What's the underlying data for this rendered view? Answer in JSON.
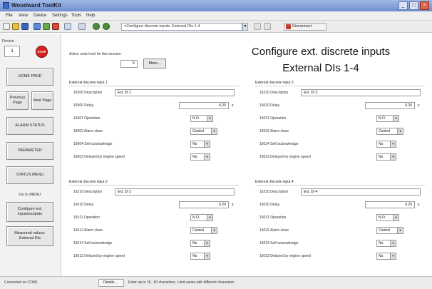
{
  "window": {
    "title": "Woodward ToolKit",
    "buttons": {
      "minimize": "_",
      "maximize": "□",
      "close": "×"
    }
  },
  "menu": [
    "File",
    "View",
    "Device",
    "Settings",
    "Tools",
    "Help"
  ],
  "toolbar": {
    "page_combo": "<Configure discrete inputs: External DIs 1-4",
    "disconnect_label": "Disconnect"
  },
  "sidebar": {
    "device_label": "Device",
    "device_value": "1",
    "stop_label": "STOP",
    "home_page": "HOME PAGE",
    "previous_page": "Previous Page",
    "next_page": "Next Page",
    "alarm_status": "ALARM STATUS",
    "parameter": "PARAMETER",
    "status_menu": "STATUS MENU",
    "goto_menu": "Go to MENU",
    "configure_ext": "Configure ext. inputs/outputs",
    "measured_values": "Measured values: External DIs"
  },
  "header": {
    "title": "Configure ext. discrete inputs",
    "subtitle": "External DIs 1-4",
    "access_code_label": "Active code level for this session:",
    "access_code_value": "5",
    "more_button": "More..."
  },
  "groups": [
    {
      "title": "External discrete input 1",
      "desc_label": "16200 Description",
      "desc_value": "Ext. DI 1",
      "delay_label": "16000 Delay",
      "delay_value": "0.20",
      "unit": "s",
      "operation_label": "16001 Operation",
      "operation_value": "N.O.",
      "alarm_label": "16002 Alarm class",
      "alarm_value": "Control",
      "selfack_label": "16004 Self acknowledge",
      "selfack_value": "No",
      "engine_label": "16003 Delayed by engine speed",
      "engine_value": "No"
    },
    {
      "title": "External discrete input 3",
      "desc_label": "16220 Description",
      "desc_value": "Ext. DI 3",
      "delay_label": "16020 Delay",
      "delay_value": "0.20",
      "unit": "s",
      "operation_label": "16021 Operation",
      "operation_value": "N.O.",
      "alarm_label": "16022 Alarm class",
      "alarm_value": "Control",
      "selfack_label": "16024 Self acknowledge",
      "selfack_value": "No",
      "engine_label": "16023 Delayed by engine speed",
      "engine_value": "No"
    },
    {
      "title": "External discrete input 2",
      "desc_label": "16210 Description",
      "desc_value": "Ext. DI 2",
      "delay_label": "16010 Delay",
      "delay_value": "0.20",
      "unit": "s",
      "operation_label": "16011 Operation",
      "operation_value": "N.O.",
      "alarm_label": "16012 Alarm class",
      "alarm_value": "Control",
      "selfack_label": "16014 Self acknowledge",
      "selfack_value": "No",
      "engine_label": "16013 Delayed by engine speed",
      "engine_value": "No"
    },
    {
      "title": "External discrete input 4",
      "desc_label": "16230 Description",
      "desc_value": "Ext. DI 4",
      "delay_label": "16030 Delay",
      "delay_value": "0.20",
      "unit": "s",
      "operation_label": "16031 Operation",
      "operation_value": "N.O.",
      "alarm_label": "16032 Alarm class",
      "alarm_value": "Control",
      "selfack_label": "16034 Self acknowledge",
      "selfack_value": "No",
      "engine_label": "16033 Delayed by engine speed",
      "engine_value": "No"
    }
  ],
  "statusbar": {
    "connection": "Connected on COM1",
    "details": "Details...",
    "hint": "Enter up to 15...90 characters. Limit varies with different characters."
  }
}
